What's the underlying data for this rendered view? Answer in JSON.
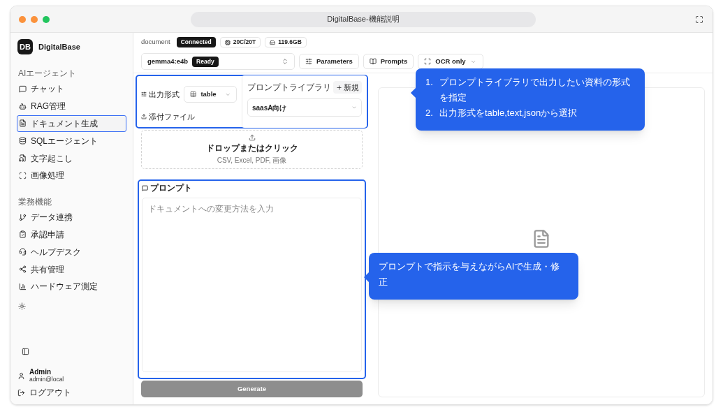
{
  "window": {
    "title": "DigitalBase-機能説明"
  },
  "sidebar": {
    "logo": "DB",
    "brand": "DigitalBase",
    "sections": [
      {
        "heading": "AIエージェント",
        "items": [
          {
            "label": "チャット",
            "selected": false
          },
          {
            "label": "RAG管理",
            "selected": false
          },
          {
            "label": "ドキュメント生成",
            "selected": true
          },
          {
            "label": "SQLエージェント",
            "selected": false
          },
          {
            "label": "文字起こし",
            "selected": false
          },
          {
            "label": "画像処理",
            "selected": false
          }
        ]
      },
      {
        "heading": "業務機能",
        "items": [
          {
            "label": "データ連携",
            "selected": false
          },
          {
            "label": "承認申請",
            "selected": false
          },
          {
            "label": "ヘルプデスク",
            "selected": false
          },
          {
            "label": "共有管理",
            "selected": false
          },
          {
            "label": "ハードウェア測定",
            "selected": false
          }
        ]
      }
    ],
    "user": {
      "name": "Admin",
      "email": "admin@local"
    },
    "logout": "ログアウト"
  },
  "header": {
    "context": "document",
    "status": "Connected",
    "cpu": "20C/20T",
    "storage": "119.6GB"
  },
  "toolbar": {
    "model": "gemma4:e4b",
    "model_status": "Ready",
    "buttons": [
      "Parameters",
      "Prompts"
    ],
    "ocr": "OCR only"
  },
  "settings": {
    "highlighted": true,
    "output_format_label": "出力形式",
    "output_format": "table",
    "attach_label": "添付ファイル",
    "library": {
      "title": "プロンプトライブラリ",
      "new_button": "新規",
      "value": "saasA向け"
    }
  },
  "dropzone": {
    "title": "ドロップまたはクリック",
    "hint": "CSV, Excel, PDF, 画像"
  },
  "prompt": {
    "highlighted": true,
    "label": "プロンプト",
    "placeholder": "ドキュメントへの変更方法を入力"
  },
  "generate": {
    "label": "Generate",
    "disabled": true
  },
  "callouts": [
    {
      "lines": [
        {
          "number": "1.",
          "text": "プロンプトライブラリで出力したい資料の形式を指定"
        },
        {
          "number": "2.",
          "text": "出力形式をtable,text,jsonから選択"
        }
      ]
    },
    {
      "lines": [
        {
          "text": "プロンプトで指示を与えながらAIで生成・修正"
        }
      ]
    }
  ]
}
